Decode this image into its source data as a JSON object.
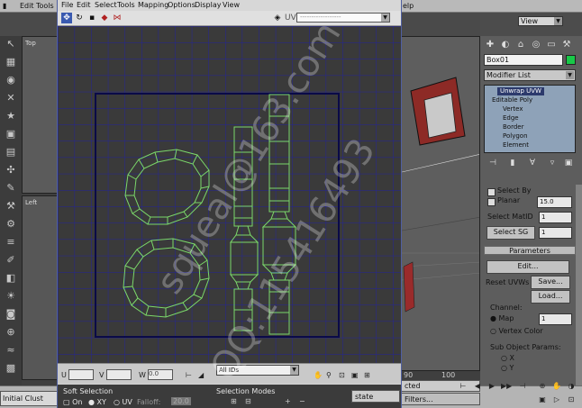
{
  "main_menu": {
    "partial_edit": "Edit",
    "partial_tools": "Tools",
    "partial_help": "elp"
  },
  "left_viewports": {
    "top_label": "Top",
    "left_label": "Left"
  },
  "view_dropdown": "View",
  "command_panel": {
    "object_name": "Box01",
    "object_color": "#18c848",
    "modifier_list": "Modifier List",
    "stack": [
      "Unwrap UVW",
      "Editable Poly",
      "Vertex",
      "Edge",
      "Border",
      "Polygon",
      "Element"
    ],
    "select_by": "Select By",
    "planar": "Planar",
    "planar_value": "15.0",
    "select_mat_id": "Select MatID",
    "select_mat_id_value": "1",
    "select_sg": "Select SG",
    "select_sg_value": "1",
    "parameters_header": "Parameters",
    "edit_button": "Edit...",
    "reset_uvws": "Reset UVWs",
    "save_button": "Save...",
    "load_button": "Load...",
    "channel_label": "Channel:",
    "map_label": "Map",
    "map_value": "1",
    "vertex_color": "Vertex Color",
    "sub_object_params": "Sub Object Params:",
    "x_label": "X",
    "y_label": "Y"
  },
  "uv_window": {
    "menu": [
      "File",
      "Edit",
      "Select",
      "Tools",
      "Mapping",
      "Options",
      "Display",
      "View"
    ],
    "toolbar_icons": [
      "move-icon",
      "rotate-icon",
      "scale-icon",
      "freeform-icon",
      "mirror-icon"
    ],
    "tile_dropdown": "All IDs",
    "u_label": "U",
    "v_label": "V",
    "w_label": "W",
    "w_value": "0.0",
    "soft_selection": "Soft Selection",
    "on_label": "On",
    "xy_label": "XY",
    "uv_label": "UV",
    "falloff_label": "Falloff:",
    "falloff_value": "20.0",
    "selection_modes": "Selection Modes",
    "state_button": "state"
  },
  "status_left": "Initial Clust",
  "bottom_right": {
    "selected_field": "cted",
    "filters_field": "Filters...",
    "frame_label": "90",
    "time_label": "100"
  },
  "watermark": {
    "line1": "squeal@163.com",
    "line2": "QQ:115416493"
  }
}
